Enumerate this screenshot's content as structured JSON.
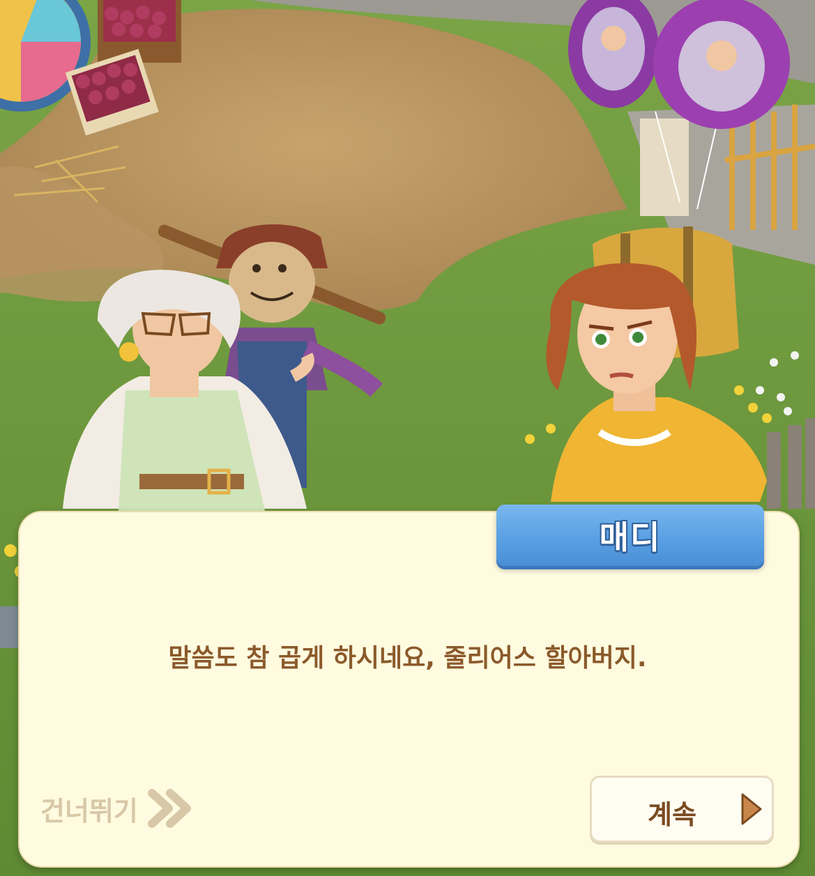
{
  "dialog": {
    "speaker_name": "매디",
    "message": "말씀도 참 곱게 하시네요, 줄리어스 할아버지.",
    "skip_label": "건너뛰기",
    "continue_label": "계속"
  },
  "icons": {
    "skip": "double-chevron-right-icon",
    "continue": "triangle-right-icon"
  },
  "colors": {
    "panel_background": "#fffbe0",
    "nameplate": "#5aa0e3",
    "message_text": "#8b5a2b",
    "skip_text": "#d8c8a8",
    "continue_text": "#7a4a20",
    "continue_arrow": "#c9864a"
  }
}
